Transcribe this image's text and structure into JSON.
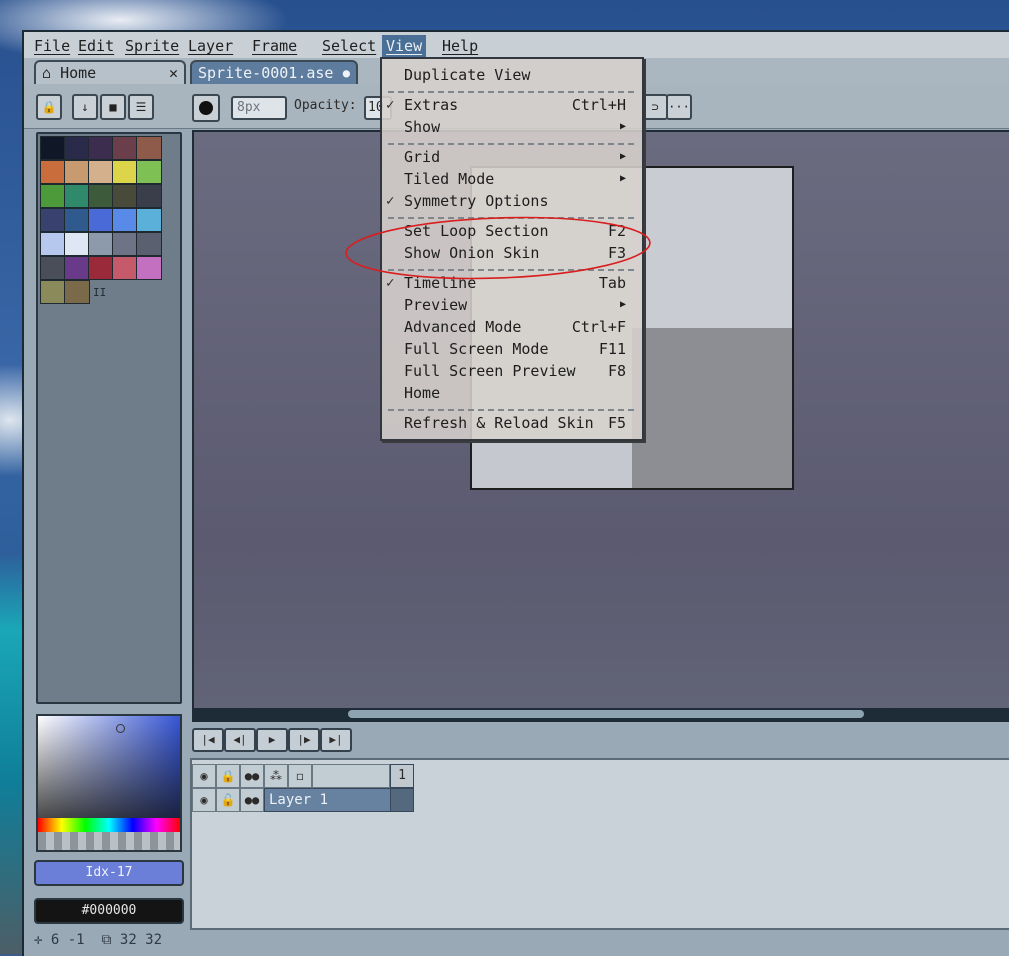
{
  "menubar": {
    "file": "File",
    "edit": "Edit",
    "sprite": "Sprite",
    "layer": "Layer",
    "frame": "Frame",
    "select": "Select",
    "view": "View",
    "help": "Help"
  },
  "tabs": {
    "home_label": "Home",
    "home_icon": "home-icon",
    "home_close": "✕",
    "sprite_label": "Sprite-0001.ase",
    "sprite_modified": "●"
  },
  "toolbar": {
    "size_value": "8px",
    "opacity_label": "Opacity:",
    "opacity_value": "10",
    "more": "···"
  },
  "view_menu": {
    "duplicate_view": "Duplicate View",
    "extras": "Extras",
    "extras_shortcut": "Ctrl+H",
    "show": "Show",
    "grid": "Grid",
    "tiled_mode": "Tiled Mode",
    "symmetry_options": "Symmetry Options",
    "set_loop_section": "Set Loop Section",
    "set_loop_section_shortcut": "F2",
    "show_onion_skin": "Show Onion Skin",
    "show_onion_skin_shortcut": "F3",
    "timeline": "Timeline",
    "timeline_shortcut": "Tab",
    "preview": "Preview",
    "advanced_mode": "Advanced Mode",
    "advanced_mode_shortcut": "Ctrl+F",
    "full_screen_mode": "Full Screen Mode",
    "full_screen_mode_shortcut": "F11",
    "full_screen_preview": "Full Screen Preview",
    "full_screen_preview_shortcut": "F8",
    "home": "Home",
    "refresh_reload_skin": "Refresh & Reload Skin",
    "refresh_reload_skin_shortcut": "F5",
    "check_glyph": "✓",
    "submenu_glyph": "▶"
  },
  "palette": {
    "colors": [
      "#101828",
      "#2a2a4a",
      "#3c2c4e",
      "#6a3e4a",
      "#8e5a4a",
      "#c96d3c",
      "#c89a70",
      "#d5b08c",
      "#dcd54a",
      "#7fc055",
      "#4c9a3a",
      "#2e8a6a",
      "#3d5a3a",
      "#4a4a3a",
      "#3a3e4a",
      "#39416e",
      "#2e5a8e",
      "#4a6ad8",
      "#5a8ae8",
      "#5ab0d8",
      "#b6c8ee",
      "#dfe6f4",
      "#8c9aac",
      "#6e7486",
      "#5a6070",
      "#4a4e58",
      "#6a3a8a",
      "#9a2a3a",
      "#c45a6a",
      "#c470c0",
      "#8a8a5a",
      "#7a6a4a"
    ],
    "mark": "II"
  },
  "colors": {
    "fg_label": "Idx-17",
    "fg_hex": "#6b7fd8",
    "bg_label": "#000000",
    "bg_hex": "#000000"
  },
  "status": {
    "cursor_pos": "6 -1",
    "sprite_size": "32 32"
  },
  "timeline": {
    "frame_number": "1",
    "layer_name": "Layer 1"
  }
}
